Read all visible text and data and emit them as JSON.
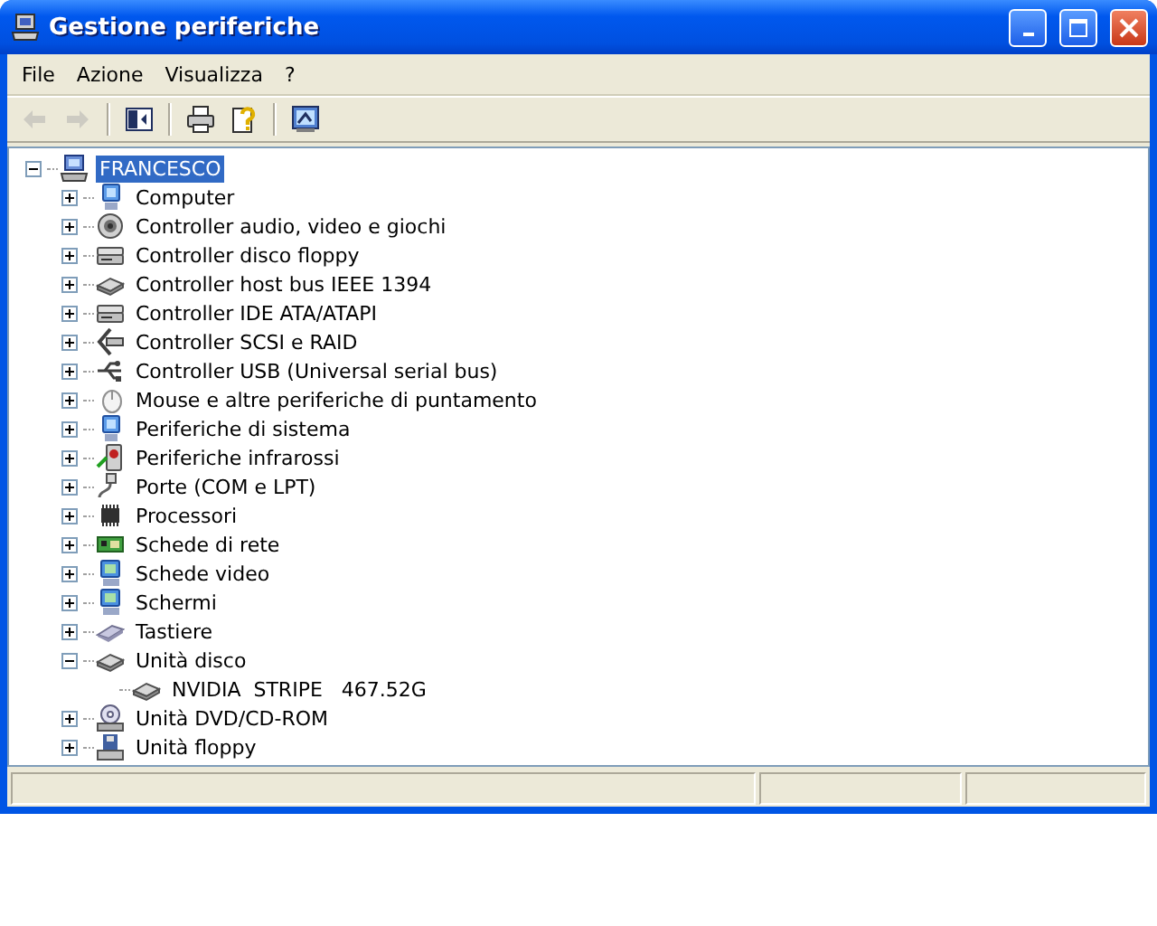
{
  "window": {
    "title": "Gestione periferiche"
  },
  "menu": [
    "File",
    "Azione",
    "Visualizza",
    "?"
  ],
  "toolbar": [
    {
      "kind": "back",
      "disabled": true
    },
    {
      "kind": "forward",
      "disabled": true
    },
    {
      "kind": "sep"
    },
    {
      "kind": "tree",
      "disabled": false
    },
    {
      "kind": "sep"
    },
    {
      "kind": "print",
      "disabled": false
    },
    {
      "kind": "help",
      "disabled": false
    },
    {
      "kind": "sep"
    },
    {
      "kind": "scan",
      "disabled": false
    }
  ],
  "tree": [
    {
      "label": "FRANCESCO",
      "kind": "computer",
      "expanded": true,
      "selected": true,
      "children": [
        {
          "label": "Computer",
          "kind": "monitor",
          "expanded": false,
          "selected": false
        },
        {
          "label": "Controller audio, video e giochi",
          "kind": "speaker",
          "expanded": false,
          "selected": false
        },
        {
          "label": "Controller disco floppy",
          "kind": "drive",
          "expanded": false,
          "selected": false
        },
        {
          "label": "Controller host bus IEEE 1394",
          "kind": "disk",
          "expanded": false,
          "selected": false
        },
        {
          "label": "Controller IDE ATA/ATAPI",
          "kind": "drive",
          "expanded": false,
          "selected": false
        },
        {
          "label": "Controller SCSI e RAID",
          "kind": "scsi",
          "expanded": false,
          "selected": false
        },
        {
          "label": "Controller USB (Universal serial bus)",
          "kind": "usb",
          "expanded": false,
          "selected": false
        },
        {
          "label": "Mouse e altre periferiche di puntamento",
          "kind": "mouse",
          "expanded": false,
          "selected": false
        },
        {
          "label": "Periferiche di sistema",
          "kind": "monitor",
          "expanded": false,
          "selected": false
        },
        {
          "label": "Periferiche infrarossi",
          "kind": "infrared",
          "expanded": false,
          "selected": false
        },
        {
          "label": "Porte (COM e LPT)",
          "kind": "port",
          "expanded": false,
          "selected": false
        },
        {
          "label": "Processori",
          "kind": "chip",
          "expanded": false,
          "selected": false
        },
        {
          "label": "Schede di rete",
          "kind": "network",
          "expanded": false,
          "selected": false
        },
        {
          "label": "Schede video",
          "kind": "display",
          "expanded": false,
          "selected": false
        },
        {
          "label": "Schermi",
          "kind": "display",
          "expanded": false,
          "selected": false
        },
        {
          "label": "Tastiere",
          "kind": "keyboard",
          "expanded": false,
          "selected": false
        },
        {
          "label": "Unità disco",
          "kind": "disk",
          "expanded": true,
          "selected": false,
          "children": [
            {
              "label": "NVIDIA  STRIPE   467.52G",
              "kind": "disk",
              "selected": false
            }
          ]
        },
        {
          "label": "Unità DVD/CD-ROM",
          "kind": "cdrom",
          "expanded": false,
          "selected": false
        },
        {
          "label": "Unità floppy",
          "kind": "floppy",
          "expanded": false,
          "selected": false
        }
      ]
    }
  ]
}
